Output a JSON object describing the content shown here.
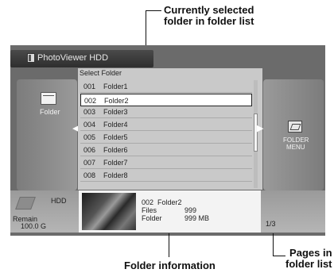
{
  "callouts": {
    "selected": [
      "Currently selected",
      "folder in folder list"
    ],
    "info": "Folder information",
    "pages": [
      "Pages in",
      "folder list"
    ]
  },
  "header": {
    "app_title": "PhotoViewer HDD",
    "column_label": "Select Folder"
  },
  "left_panel": {
    "label": "Folder",
    "icon": "folder-icon"
  },
  "right_panel": {
    "label": [
      "FOLDER",
      "MENU"
    ],
    "icon": "folder-menu-icon"
  },
  "folders": [
    {
      "num": "001",
      "name": "Folder1"
    },
    {
      "num": "002",
      "name": "Folder2"
    },
    {
      "num": "003",
      "name": "Folder3"
    },
    {
      "num": "004",
      "name": "Folder4"
    },
    {
      "num": "005",
      "name": "Folder5"
    },
    {
      "num": "006",
      "name": "Folder6"
    },
    {
      "num": "007",
      "name": "Folder7"
    },
    {
      "num": "008",
      "name": "Folder8"
    }
  ],
  "selected_index": 1,
  "storage": {
    "device": "HDD",
    "remain_label": "Remain",
    "remain_value": "100.0 G"
  },
  "info": {
    "title": "002  Folder2",
    "files_label": "Files",
    "files_value": "999",
    "size_label": "Folder",
    "size_value": "999 MB"
  },
  "page_indicator": "1/3",
  "colors": {
    "screen_bg": "#6b6b6b",
    "list_bg": "#c9c9c9",
    "selected_bg": "#ffffff"
  }
}
